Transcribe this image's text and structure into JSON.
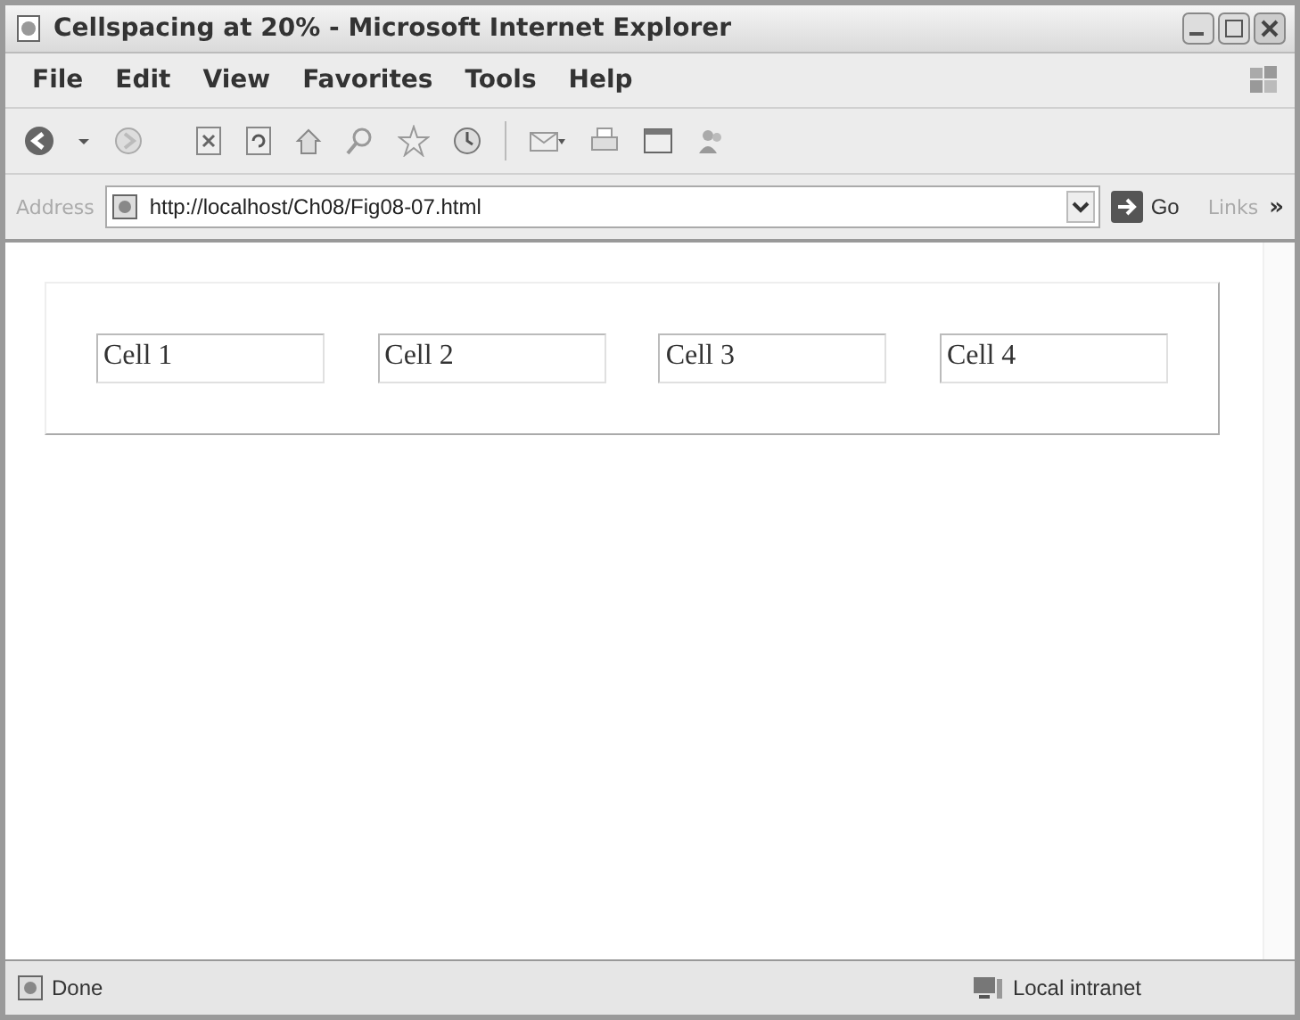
{
  "window": {
    "title": "Cellspacing at 20% - Microsoft Internet Explorer"
  },
  "menu": [
    "File",
    "Edit",
    "View",
    "Favorites",
    "Tools",
    "Help"
  ],
  "address_bar": {
    "label": "Address",
    "url": "http://localhost/Ch08/Fig08-07.html",
    "go": "Go",
    "links": "Links",
    "more": "»"
  },
  "table": {
    "cells": [
      "Cell 1",
      "Cell 2",
      "Cell 3",
      "Cell 4"
    ]
  },
  "status_bar": {
    "status": "Done",
    "zone": "Local intranet"
  }
}
